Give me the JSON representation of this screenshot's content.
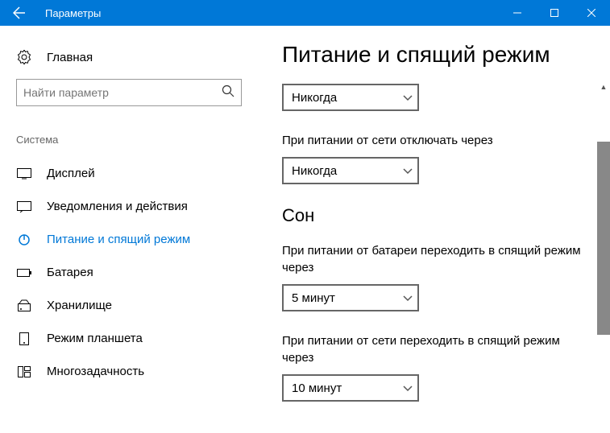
{
  "window": {
    "title": "Параметры"
  },
  "sidebar": {
    "home": "Главная",
    "searchPlaceholder": "Найти параметр",
    "category": "Система",
    "items": [
      {
        "label": "Дисплей"
      },
      {
        "label": "Уведомления и действия"
      },
      {
        "label": "Питание и спящий режим"
      },
      {
        "label": "Батарея"
      },
      {
        "label": "Хранилище"
      },
      {
        "label": "Режим планшета"
      },
      {
        "label": "Многозадачность"
      }
    ]
  },
  "main": {
    "title": "Питание и спящий режим",
    "screenOff1": {
      "value": "Никогда"
    },
    "screenOff2": {
      "label": "При питании от сети отключать через",
      "value": "Никогда"
    },
    "sleepHeading": "Сон",
    "sleep1": {
      "label": "При питании от батареи переходить в спящий режим через",
      "value": "5 минут"
    },
    "sleep2": {
      "label": "При питании от сети переходить в спящий режим через",
      "value": "10 минут"
    }
  }
}
